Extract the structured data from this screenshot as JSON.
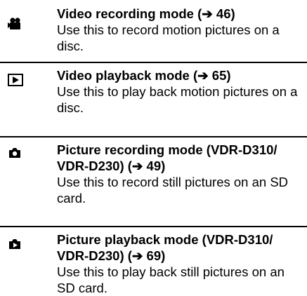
{
  "modes": [
    {
      "icon": "video-camera-icon",
      "title": "Video recording mode (➔ 46)",
      "description": "Use this to record motion pictures on a disc."
    },
    {
      "icon": "play-button-icon",
      "title": "Video playback mode (➔ 65)",
      "description": "Use this to play back motion pictures on a disc."
    },
    {
      "icon": "still-camera-icon",
      "title": "Picture recording mode (VDR-D310/ VDR-D230) (➔ 49)",
      "description": "Use this to record still pictures on an SD card."
    },
    {
      "icon": "picture-playback-icon",
      "title": "Picture playback mode (VDR-D310/ VDR-D230) (➔ 69)",
      "description": "Use this to play back still pictures on an SD card."
    }
  ]
}
